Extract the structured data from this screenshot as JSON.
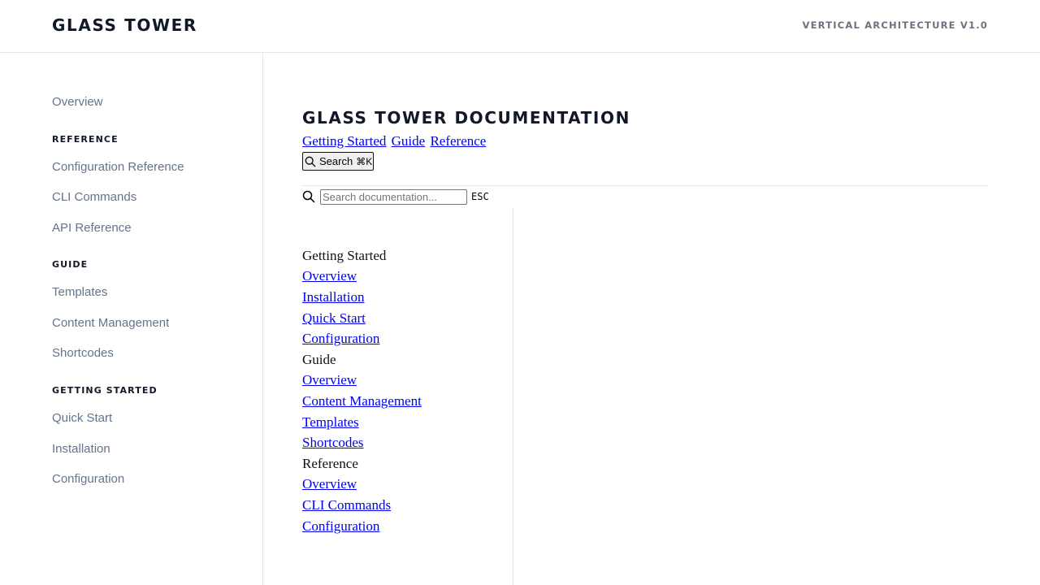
{
  "header": {
    "brand": "GLASS TOWER",
    "version": "VERTICAL ARCHITECTURE V1.0"
  },
  "sidebar": {
    "overview": "Overview",
    "sections": [
      {
        "heading": "REFERENCE",
        "items": [
          "Configuration Reference",
          "CLI Commands",
          "API Reference"
        ]
      },
      {
        "heading": "GUIDE",
        "items": [
          "Templates",
          "Content Management",
          "Shortcodes"
        ]
      },
      {
        "heading": "GETTING STARTED",
        "items": [
          "Quick Start",
          "Installation",
          "Configuration"
        ]
      }
    ]
  },
  "main": {
    "title": "GLASS TOWER DOCUMENTATION",
    "top_links": [
      "Getting Started",
      "Guide",
      "Reference"
    ],
    "search_button": {
      "label": "Search",
      "shortcut": "⌘K"
    },
    "search": {
      "placeholder": "Search documentation...",
      "value": "",
      "esc_label": "ESC"
    },
    "results": [
      {
        "group": "Getting Started",
        "links": [
          "Overview",
          "Installation",
          "Quick Start",
          "Configuration"
        ]
      },
      {
        "group": "Guide",
        "links": [
          "Overview",
          "Content Management",
          "Templates",
          "Shortcodes"
        ]
      },
      {
        "group": "Reference",
        "links": [
          "Overview",
          "CLI Commands",
          "Configuration"
        ]
      }
    ]
  }
}
